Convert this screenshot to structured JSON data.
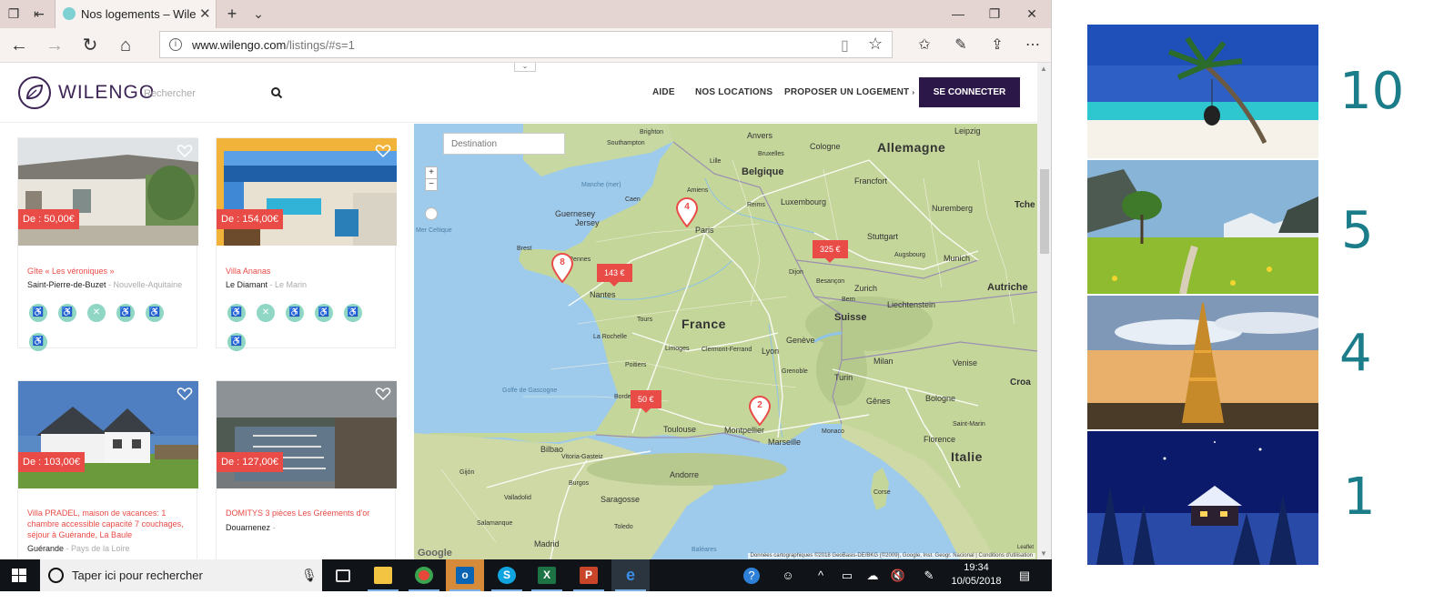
{
  "browser": {
    "tab_title": "Nos logements – Wilengo",
    "url_domain": "www.wilengo.com",
    "url_path": "/listings/#s=1"
  },
  "site": {
    "logo_text": "WILENGO",
    "search_placeholder": "Rechercher",
    "nav": [
      "AIDE",
      "NOS LOCATIONS",
      "PROPOSER UN LOGEMENT"
    ],
    "login_label": "SE CONNECTER"
  },
  "listings": [
    {
      "price": "De : 50,00€",
      "title": "Gîte « Les véroniques »",
      "city": "Saint-Pierre-de-Buzet",
      "region": " - Nouvelle-Aquitaine",
      "amenities": 6
    },
    {
      "price": "De : 154,00€",
      "title": "Villa Ananas",
      "city": "Le Diamant",
      "region": " - Le Marin",
      "amenities": 6
    },
    {
      "price": "De : 103,00€",
      "title": "Villa PRADEL, maison de vacances: 1 chambre accessible capacité 7 couchages, séjour à Guérande, La Baule",
      "city": "Guérande",
      "region": " - Pays de la Loire"
    },
    {
      "price": "De : 127,00€",
      "title": "DOMITYS 3 pièces Les Gréements d'or",
      "city": "Douarnenez",
      "region": " -"
    }
  ],
  "map": {
    "search_placeholder": "Destination",
    "zoom_in": "+",
    "zoom_out": "−",
    "price_markers": [
      "143 €",
      "325 €",
      "50 €"
    ],
    "clusters": [
      "4",
      "8",
      "2"
    ],
    "countries": [
      "France",
      "Allemagne",
      "Belgique",
      "Suisse",
      "Italie",
      "Autriche",
      "Liechtenstein"
    ],
    "cities": [
      "Leipzig",
      "Anvers",
      "Cologne",
      "Francfort",
      "Luxembourg",
      "Nuremberg",
      "Stuttgart",
      "Munich",
      "Augsbourg",
      "Zurich",
      "Paris",
      "Nantes",
      "Brest",
      "Guernesey",
      "Jersey",
      "La Rochelle",
      "Limoges",
      "Clermont-Ferrand",
      "Lyon",
      "Genève",
      "Grenoble",
      "Turin",
      "Milan",
      "Gênes",
      "Bologne",
      "Venise",
      "Florence",
      "Monaco",
      "Marseille",
      "Montpellier",
      "Toulouse",
      "Bordeaux",
      "Bilbao",
      "Vitoria-Gasteiz",
      "Andorre",
      "Saragosse",
      "Valladolid",
      "Salamanque",
      "Madrid",
      "Saint-Marin",
      "Croa",
      "Tche",
      "Tours",
      "Bruxelles",
      "Lille",
      "Southampton",
      "Caen",
      "Amiens",
      "Reims",
      "Dijon",
      "Besançon",
      "Bern",
      "Poitiers",
      "Brighton",
      "Rennes",
      "Gijón",
      "Burgos",
      "Toledo",
      "Mer Celtique",
      "Manche (mer)",
      "Golfe de Gascogne",
      "Baléares",
      "Corse"
    ],
    "attribution": "Données cartographiques ©2018 GeoBasis-DE/BKG (©2009), Google, Inst. Geogr. Nacional",
    "terms": "Conditions d'utilisation",
    "leaflet": "Leaflet",
    "google": "Google"
  },
  "taskbar": {
    "search_text": "Taper ici pour rechercher",
    "time": "19:34",
    "date": "10/05/2018"
  },
  "side": {
    "ranks": [
      "10",
      "5",
      "4",
      "1"
    ]
  }
}
